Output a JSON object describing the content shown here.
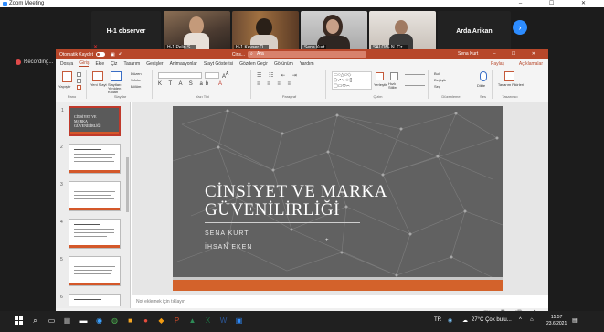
{
  "zoom": {
    "window_title": "Zoom Meeting",
    "window_controls": "–   ☐   ✕",
    "participants": [
      {
        "name": "H-1 observer"
      },
      {
        "name": "H-1 Pelin S...",
        "video": true
      },
      {
        "name": "H-1 Kevser Ö...",
        "video": true
      },
      {
        "name": "Sena Kurt",
        "video": true
      },
      {
        "name": "SALON- N. Cz...",
        "video": true
      },
      {
        "name": "Arda Arikan"
      }
    ],
    "next_icon": "chevron-right-icon",
    "recording_label": "Recording..."
  },
  "powerpoint": {
    "autosave_label": "Otomatik Kaydet",
    "autosave_state": "off",
    "file_name": "Cins...",
    "search_placeholder": "Ara",
    "user_name": "Sena Kurt",
    "window_buttons": "–  ☐  ✕",
    "tabs": [
      "Dosya",
      "Giriş",
      "Ekle",
      "Çiz",
      "Tasarım",
      "Geçişler",
      "Animasyonlar",
      "Slayt Gösterisi",
      "Gözden Geçir",
      "Görünüm",
      "Yardım"
    ],
    "active_tab": "Giriş",
    "share_label": "Paylaş",
    "comments_label": "Açıklamalar",
    "ribbon_groups": [
      "Pano",
      "Slaytlar",
      "Yazı Tipi",
      "Paragraf",
      "Çizim",
      "Düzenleme",
      "Ses",
      "Tasarımcı"
    ],
    "ribbon_labels": {
      "paste": "Yapıştır",
      "new_slide": "Yeni Slayt",
      "reuse": "Slaytları Yeniden Kullan",
      "layout": "Düzen",
      "reset": "Sıfırla",
      "section": "Bölüm",
      "find": "Bul",
      "replace": "Değiştir",
      "select": "Seç",
      "dictate": "Dikte",
      "design_ideas": "Tasarım Fikirleri",
      "arrange": "Yerleştir",
      "quick_styles": "Hızlı Stiller"
    },
    "slides_count": 6,
    "slide": {
      "title_line1": "CİNSİYET VE MARKA",
      "title_line2": "GÜVENİLİRLİĞİ",
      "author1": "SENA KURT",
      "author2": "İHSAN EKEN"
    },
    "thumb1_title": "CİNSİYET VE MARKA GÜVENİLİRLİĞİ",
    "notes_placeholder": "Not eklemek için tıklayın",
    "status_text": "Slayt 1 / 11   Türkçe (Türkiye)",
    "status_right": "Notlar",
    "zoom_level": "54%"
  },
  "taskbar": {
    "weather": "27°C  Çok bulu...",
    "time": "15:57",
    "date": "23.6.2021",
    "extra": "TR"
  },
  "colors": {
    "ppt_accent": "#b7472a",
    "slide_bg": "#616161",
    "slide_bar": "#d3622b",
    "zoom_blue": "#2d8cff"
  }
}
